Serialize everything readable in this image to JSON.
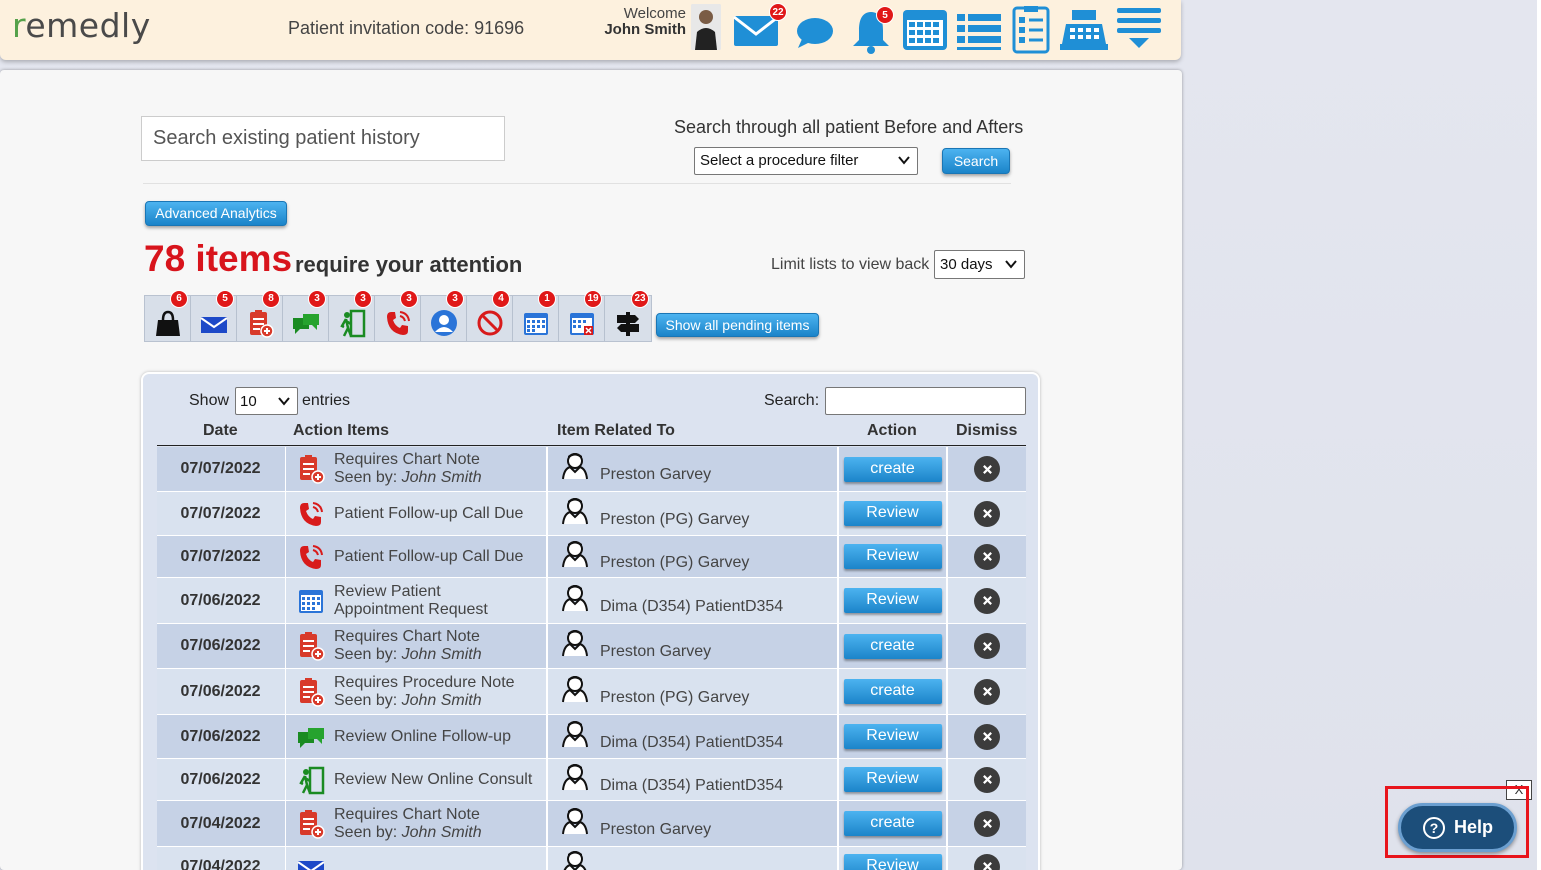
{
  "header": {
    "logo": "remedly",
    "invitation": "Patient invitation code: 91696",
    "welcome": "Welcome",
    "user_name": "John Smith",
    "badges": {
      "mail": "22",
      "bell": "5"
    }
  },
  "search": {
    "placeholder": "Search existing patient history",
    "before_after_label": "Search through all patient Before and Afters",
    "procedure_filter": "Select a procedure filter",
    "button": "Search"
  },
  "analytics_button": "Advanced Analytics",
  "attention": {
    "count": "78 items",
    "text": "require your attention",
    "limit_label": "Limit lists to view back",
    "limit_value": "30 days"
  },
  "strip": [
    {
      "icon": "shopping-bag-icon",
      "badge": "6"
    },
    {
      "icon": "mail-icon",
      "badge": "5"
    },
    {
      "icon": "chart-note-icon",
      "badge": "8"
    },
    {
      "icon": "chat-icon",
      "badge": "3"
    },
    {
      "icon": "walk-in-icon",
      "badge": "3"
    },
    {
      "icon": "phone-call-icon",
      "badge": "3"
    },
    {
      "icon": "user-circle-icon",
      "badge": "3"
    },
    {
      "icon": "cancel-icon",
      "badge": "4"
    },
    {
      "icon": "calendar-icon",
      "badge": "1"
    },
    {
      "icon": "calendar-x-icon",
      "badge": "19"
    },
    {
      "icon": "signpost-icon",
      "badge": "23"
    }
  ],
  "pending_button": "Show all pending items",
  "table": {
    "show_label": "Show",
    "show_value": "10",
    "entries_label": "entries",
    "search_label": "Search:",
    "headers": [
      "Date",
      "Action Items",
      "Item Related To",
      "Action",
      "Dismiss"
    ],
    "rows": [
      {
        "date": "07/07/2022",
        "icon": "chart-note",
        "line1": "Requires Chart Note",
        "seen_prefix": "Seen by: ",
        "seen_by": "John Smith",
        "patient": "Preston Garvey",
        "action": "create"
      },
      {
        "date": "07/07/2022",
        "icon": "phone",
        "line1": "Patient Follow-up Call Due",
        "seen_prefix": "",
        "seen_by": "",
        "patient": "Preston (PG) Garvey",
        "action": "Review"
      },
      {
        "date": "07/07/2022",
        "icon": "phone",
        "line1": "Patient Follow-up Call Due",
        "seen_prefix": "",
        "seen_by": "",
        "patient": "Preston (PG) Garvey",
        "action": "Review"
      },
      {
        "date": "07/06/2022",
        "icon": "calendar",
        "line1": "Review Patient",
        "line2": "Appointment Request",
        "seen_prefix": "",
        "seen_by": "",
        "patient": "Dima (D354) PatientD354",
        "action": "Review"
      },
      {
        "date": "07/06/2022",
        "icon": "chart-note",
        "line1": "Requires Chart Note",
        "seen_prefix": "Seen by: ",
        "seen_by": "John Smith",
        "patient": "Preston Garvey",
        "action": "create"
      },
      {
        "date": "07/06/2022",
        "icon": "chart-note",
        "line1": "Requires Procedure Note",
        "seen_prefix": "Seen by: ",
        "seen_by": "John Smith",
        "patient": "Preston (PG) Garvey",
        "action": "create"
      },
      {
        "date": "07/06/2022",
        "icon": "chat",
        "line1": "Review Online Follow-up",
        "seen_prefix": "",
        "seen_by": "",
        "patient": "Dima (D354) PatientD354",
        "action": "Review"
      },
      {
        "date": "07/06/2022",
        "icon": "walk-in",
        "line1": "Review New Online Consult",
        "seen_prefix": "",
        "seen_by": "",
        "patient": "Dima (D354) PatientD354",
        "action": "Review"
      },
      {
        "date": "07/04/2022",
        "icon": "chart-note",
        "line1": "Requires Chart Note",
        "seen_prefix": "Seen by: ",
        "seen_by": "John Smith",
        "patient": "Preston Garvey",
        "action": "create"
      },
      {
        "date": "07/04/2022",
        "icon": "mail",
        "line1": "",
        "seen_prefix": "",
        "seen_by": "",
        "patient": "",
        "action": "Review"
      }
    ]
  },
  "help": {
    "label": "Help",
    "close": "X"
  },
  "colors": {
    "accent_red": "#d8141c",
    "button_blue": "#1b84c9",
    "header_bg": "#fdf1de"
  }
}
